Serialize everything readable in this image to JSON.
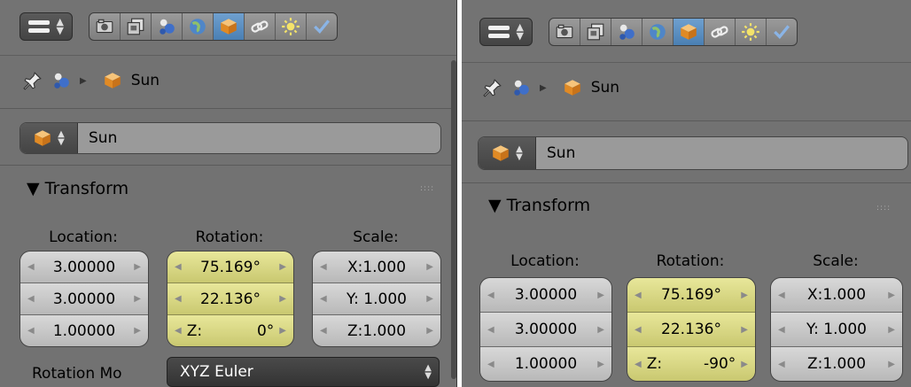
{
  "panels": [
    {
      "breadcrumb_object": "Sun",
      "object_name": "Sun",
      "transform_title": "Transform",
      "labels": {
        "location": "Location:",
        "rotation": "Rotation:",
        "scale": "Scale:"
      },
      "location": [
        "3.00000",
        "3.00000",
        "1.00000"
      ],
      "rotation": [
        "75.169°",
        "22.136°"
      ],
      "rotation_z_label": "Z:",
      "rotation_z_value": "0°",
      "scale": [
        "X:1.000",
        "Y: 1.000",
        "Z:1.000"
      ],
      "rotation_mode_label": "Rotation Mo",
      "rotation_mode_value": "XYZ Euler"
    },
    {
      "breadcrumb_object": "Sun",
      "object_name": "Sun",
      "transform_title": "Transform",
      "labels": {
        "location": "Location:",
        "rotation": "Rotation:",
        "scale": "Scale:"
      },
      "location": [
        "3.00000",
        "3.00000",
        "1.00000"
      ],
      "rotation": [
        "75.169°",
        "22.136°"
      ],
      "rotation_z_label": "Z:",
      "rotation_z_value": "-90°",
      "scale": [
        "X:1.000",
        "Y: 1.000",
        "Z:1.000"
      ]
    }
  ],
  "tabs": [
    "render-icon",
    "render-layers-icon",
    "scene-icon",
    "world-icon",
    "object-icon",
    "constraints-icon",
    "lamp-data-icon",
    "modifiers-icon"
  ],
  "colors": {
    "panel_bg": "#727272",
    "rotation_field": "#d9d884",
    "active_tab": "#5a8ec2",
    "object_orange": "#e8962e"
  }
}
